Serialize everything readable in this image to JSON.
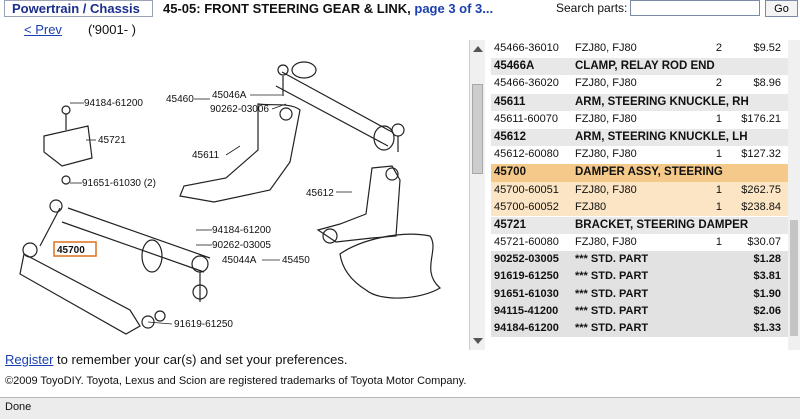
{
  "header": {
    "breadcrumb": "Powertrain / Chassis",
    "title_main": "45-05: FRONT STEERING GEAR & LINK, ",
    "title_page": "page 3 of 3...",
    "search_label": "Search parts:",
    "search_value": "",
    "go_label": "Go"
  },
  "nav": {
    "prev": "< Prev",
    "years": "('9001-      )"
  },
  "diagram": {
    "labels": [
      "45460",
      "45046A",
      "90262-03006",
      "94184-61200",
      "45721",
      "45611",
      "91651-61030 (2)",
      "45612",
      "94184-61200",
      "45700",
      "90262-03005",
      "45044A",
      "45450",
      "91619-61250"
    ]
  },
  "parts": [
    {
      "type": "item",
      "part": "45466-36010",
      "desc": "FZJ80, FJ80",
      "qty": "2",
      "price": "$9.52"
    },
    {
      "type": "head",
      "part": "45466A",
      "desc": "CLAMP, RELAY ROD END",
      "qty": "",
      "price": ""
    },
    {
      "type": "item",
      "part": "45466-36020",
      "desc": "FZJ80, FJ80",
      "qty": "2",
      "price": "$8.96"
    },
    {
      "type": "head",
      "part": "45611",
      "desc": "ARM, STEERING KNUCKLE, RH",
      "qty": "",
      "price": ""
    },
    {
      "type": "item",
      "part": "45611-60070",
      "desc": "FZJ80, FJ80",
      "qty": "1",
      "price": "$176.21"
    },
    {
      "type": "head",
      "part": "45612",
      "desc": "ARM, STEERING KNUCKLE, LH",
      "qty": "",
      "price": ""
    },
    {
      "type": "item",
      "part": "45612-60080",
      "desc": "FZJ80, FJ80",
      "qty": "1",
      "price": "$127.32"
    },
    {
      "type": "hlhead",
      "part": "45700",
      "desc": "DAMPER ASSY, STEERING",
      "qty": "",
      "price": ""
    },
    {
      "type": "hlitem",
      "part": "45700-60051",
      "desc": "FZJ80, FJ80",
      "qty": "1",
      "price": "$262.75"
    },
    {
      "type": "hlitem",
      "part": "45700-60052",
      "desc": "FZJ80",
      "qty": "1",
      "price": "$238.84"
    },
    {
      "type": "head",
      "part": "45721",
      "desc": "BRACKET, STEERING DAMPER",
      "qty": "",
      "price": ""
    },
    {
      "type": "item",
      "part": "45721-60080",
      "desc": "FZJ80, FJ80",
      "qty": "1",
      "price": "$30.07"
    },
    {
      "type": "std",
      "part": "90252-03005",
      "desc": "*** STD. PART",
      "qty": "",
      "price": "$1.28"
    },
    {
      "type": "std",
      "part": "91619-61250",
      "desc": "*** STD. PART",
      "qty": "",
      "price": "$3.81"
    },
    {
      "type": "std",
      "part": "91651-61030",
      "desc": "*** STD. PART",
      "qty": "",
      "price": "$1.90"
    },
    {
      "type": "std",
      "part": "94115-41200",
      "desc": "*** STD. PART",
      "qty": "",
      "price": "$2.06"
    },
    {
      "type": "std",
      "part": "94184-61200",
      "desc": "*** STD. PART",
      "qty": "",
      "price": "$1.33"
    }
  ],
  "footer": {
    "register_link": "Register",
    "register_text": " to remember your car(s) and set your preferences.",
    "copyright": "©2009 ToyoDIY. Toyota, Lexus and Scion are registered trademarks of Toyota Motor Company.",
    "status": "Done"
  },
  "colors": {
    "link": "#1a3fb0",
    "highlight_head": "#f4c98a",
    "highlight_row": "#fbe5c4",
    "callout_box": "#e07a2a"
  }
}
